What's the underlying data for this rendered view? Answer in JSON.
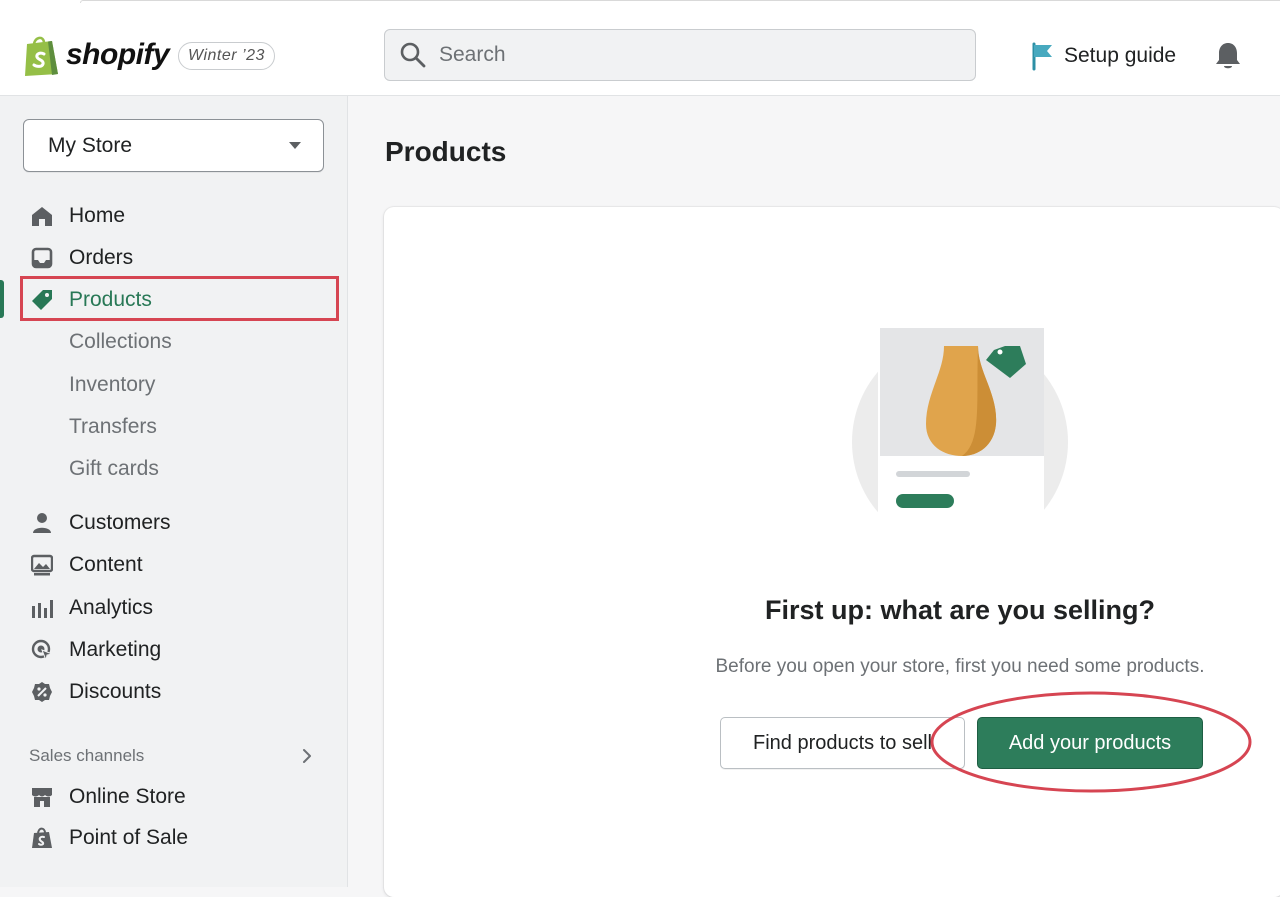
{
  "brand": {
    "name": "shopify",
    "edition": "Winter ’23",
    "accent": "#95bf47"
  },
  "header": {
    "search_placeholder": "Search",
    "setup_guide": "Setup guide"
  },
  "sidebar": {
    "store_name": "My Store",
    "items": [
      {
        "label": "Home",
        "icon": "home-icon"
      },
      {
        "label": "Orders",
        "icon": "inbox-icon"
      },
      {
        "label": "Products",
        "icon": "tag-icon",
        "active": true
      },
      {
        "label": "Collections"
      },
      {
        "label": "Inventory"
      },
      {
        "label": "Transfers"
      },
      {
        "label": "Gift cards"
      },
      {
        "label": "Customers",
        "icon": "person-icon"
      },
      {
        "label": "Content",
        "icon": "image-icon"
      },
      {
        "label": "Analytics",
        "icon": "bar-chart-icon"
      },
      {
        "label": "Marketing",
        "icon": "target-icon"
      },
      {
        "label": "Discounts",
        "icon": "discount-icon"
      }
    ],
    "sales_channels_title": "Sales channels",
    "channels": [
      {
        "label": "Online Store",
        "icon": "store-icon"
      },
      {
        "label": "Point of Sale",
        "icon": "pos-bag-icon"
      }
    ]
  },
  "main": {
    "title": "Products",
    "empty_state": {
      "heading": "First up: what are you selling?",
      "text": "Before you open your store, first you need some products.",
      "secondary_button": "Find products to sell",
      "primary_button": "Add your products"
    }
  },
  "colors": {
    "primary": "#2d7d5b",
    "active_text": "#287856",
    "annotation": "#d64552"
  }
}
